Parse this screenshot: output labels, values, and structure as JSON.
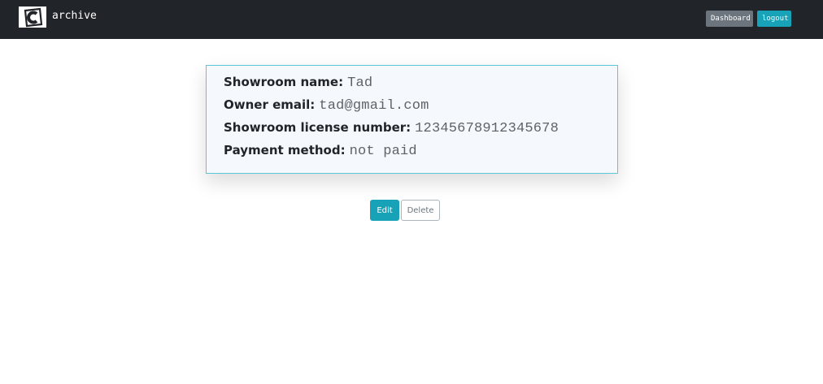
{
  "navbar": {
    "brand_text": "archive",
    "logo_icon": "c-logo-icon",
    "dashboard_label": "Dashboard",
    "logout_label": "logout"
  },
  "details": {
    "showroom_name_label": "Showroom name:",
    "showroom_name_value": "Tad",
    "owner_email_label": "Owner email:",
    "owner_email_value": "tad@gmail.com",
    "license_label": "Showroom license number:",
    "license_value": "12345678912345678",
    "payment_label": "Payment method:",
    "payment_value": "not paid"
  },
  "actions": {
    "edit_label": "Edit",
    "delete_label": "Delete"
  },
  "colors": {
    "navbar_bg": "#212529",
    "accent": "#17a2b8",
    "secondary": "#6c757d"
  }
}
